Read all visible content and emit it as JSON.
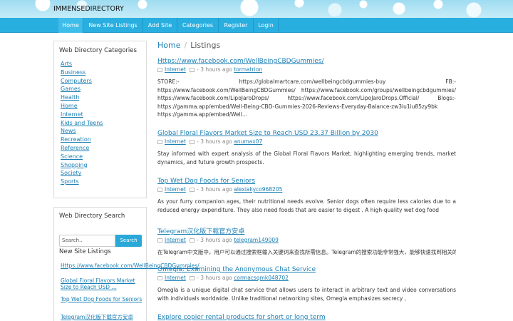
{
  "site": {
    "title": "IMMENSEDIRECTORY"
  },
  "nav": {
    "items": [
      {
        "label": "Home"
      },
      {
        "label": "New Site Listings"
      },
      {
        "label": "Add Site"
      },
      {
        "label": "Categories"
      },
      {
        "label": "Register"
      },
      {
        "label": "Login"
      }
    ]
  },
  "categories_panel": {
    "title": "Web Directory Categories",
    "items": [
      "Arts",
      "Business",
      "Computers",
      "Games",
      "Health",
      "Home",
      "Internet",
      "Kids and Teens",
      "News",
      "Recreation",
      "Reference",
      "Science",
      "Shopping",
      "Society",
      "Sports"
    ]
  },
  "search_panel": {
    "title": "Web Directory Search",
    "placeholder": "Search..",
    "button": "Search",
    "new_title": "New Site Listings",
    "new_items": [
      "Https://www.facebook.com/WellBeingCBDGummies/",
      "Global Floral Flavors Market Size to Reach USD ...",
      "Top Wet Dog Foods for Seniors",
      "Telegram汉化版下载官方安卓"
    ]
  },
  "breadcrumb": {
    "home": "Home",
    "sep": "/",
    "current": "Listings"
  },
  "listings": [
    {
      "title": "Https://www.facebook.com/WellBeingCBDGummies/",
      "category": "Internet",
      "time": "- 3 hours ago",
      "author": "tormatrion",
      "desc": "STORE:- https://globalmartcare.com/wellbeingcbdgummies-buy FB:- https://www.facebook.com/WellBeingCBDGummies/ https://www.facebook.com/groups/wellbeingcbdgummies/ https://www.facebook.com/LipoJaroDrops/ https://www.facebook.com/LipoJaroDrops.Official/ Blogs:- https://gamma.app/embed/Well-Being-CBD-Gummies-2026-Reviews-Everyday-Balance-zw3iu1iu85zy9bk https://gamma.app/embed/Well..."
    },
    {
      "title": "Global Floral Flavors Market Size to Reach USD 23.37 Billion by 2030",
      "category": "Internet",
      "time": "- 3 hours ago",
      "author": "anumax07",
      "desc": "Stay informed with expert analysis of the Global Floral Flavors Market, highlighting emerging trends, market dynamics, and future growth prospects."
    },
    {
      "title": "Top Wet Dog Foods for Seniors",
      "category": "Internet",
      "time": "- 3 hours ago",
      "author": "alexiakyco968205",
      "desc": "As your furry companion ages, their nutritional needs evolve. Senior dogs often require less calories due to a reduced energy expenditure. They also need foods that are easier to digest . A high-quality wet dog food"
    },
    {
      "title": "Telegram汉化版下载官方安卓",
      "category": "Internet",
      "time": "- 3 hours ago",
      "author": "telegram149009",
      "desc": "在Telegram中文版中，用户可以通过搜索框输入关键词来查找所需信息。Telegram的搜索功能非常强大，能够快速找到相关的聊天记录、频道和群组内容，支持多语言？?"
    },
    {
      "title": "Omegla: Examining the Anonymous Chat Service",
      "category": "Internet",
      "time": "- 3 hours ago",
      "author": "cormacsqmk048702",
      "desc": "Omegla is a unique digital chat service that allows users to interact in arbitrary text and video conversations with individuals worldwide. Unlike traditional networking sites, Omegla emphasizes secrecy ,"
    },
    {
      "title": "Explore copier rental products for short or long term",
      "category": "",
      "time": "",
      "author": "",
      "desc": ""
    }
  ]
}
